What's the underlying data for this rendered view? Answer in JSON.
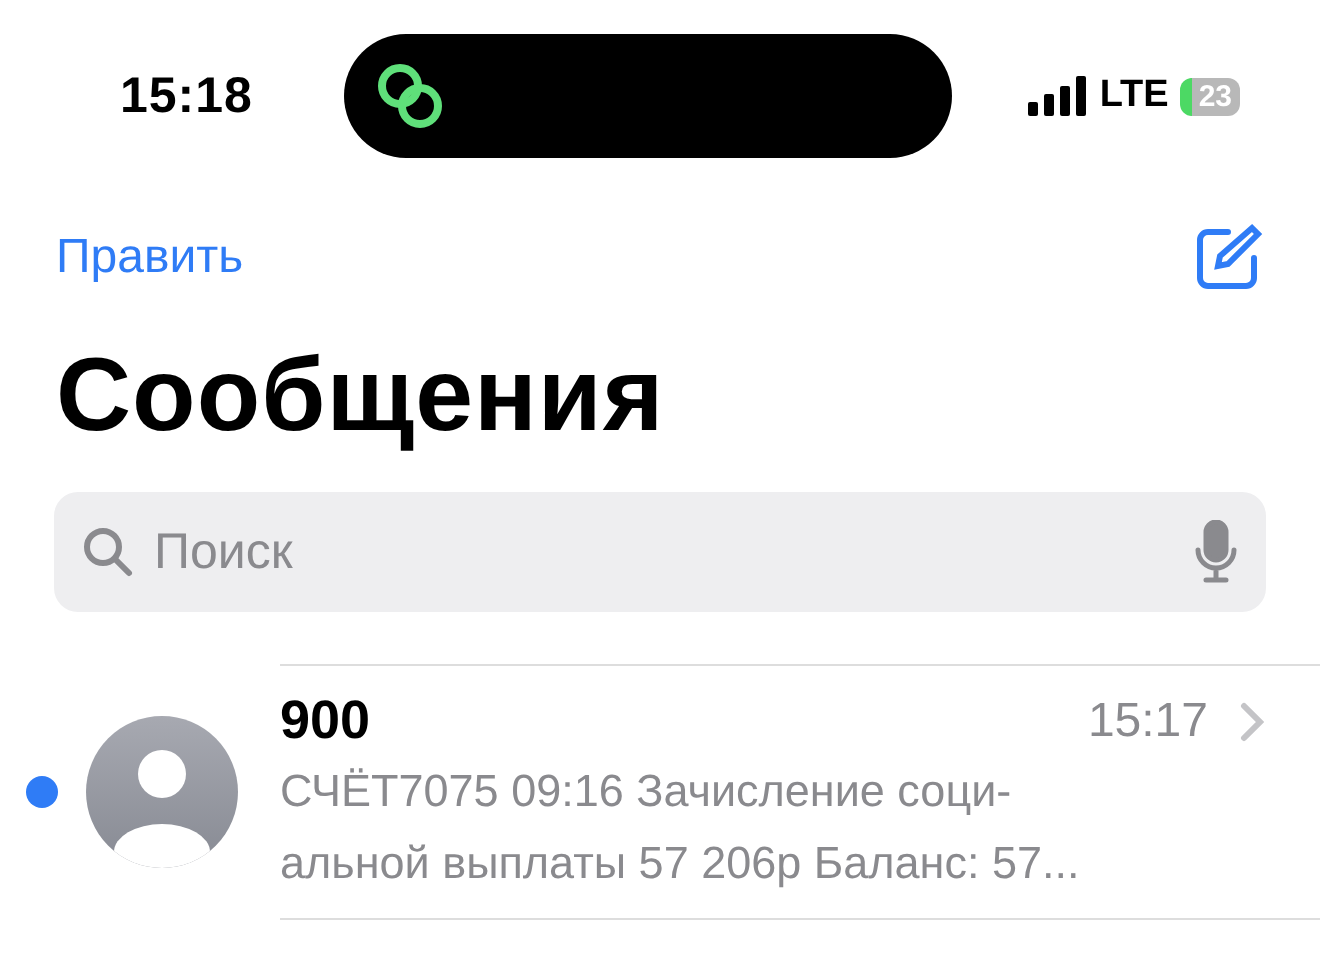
{
  "status_bar": {
    "time": "15:18",
    "network": "LTE",
    "battery": "23"
  },
  "nav": {
    "edit": "Править"
  },
  "title": "Сообщения",
  "search": {
    "placeholder": "Поиск"
  },
  "conversations": [
    {
      "name": "900",
      "time": "15:17",
      "unread": true,
      "preview": [
        "СЧЁТ7075 09:16 Зачисление соци-",
        "альной выплаты 57 206р Баланс: 57..."
      ]
    }
  ]
}
